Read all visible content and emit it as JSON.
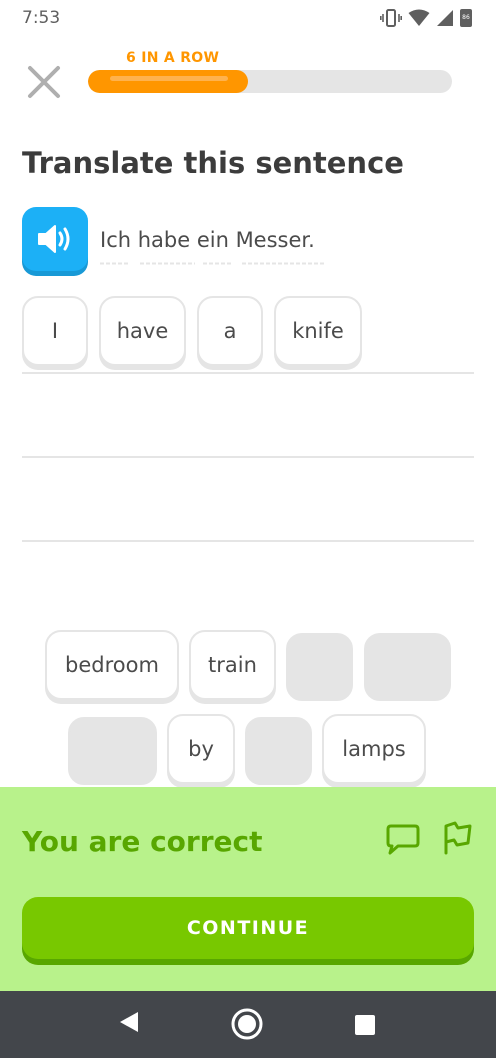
{
  "status_bar": {
    "time": "7:53",
    "battery_level": "86"
  },
  "header": {
    "streak_label": "6 IN A ROW",
    "progress_fraction": 0.44,
    "close_icon": "close-x-icon"
  },
  "exercise": {
    "title": "Translate this sentence",
    "speaker_icon": "speaker-icon",
    "sentence": "Ich habe ein Messer."
  },
  "answer": {
    "selected_words": [
      "I",
      "have",
      "a",
      "knife"
    ]
  },
  "word_bank": {
    "row1": [
      "bedroom",
      "train",
      "",
      ""
    ],
    "row2": [
      "",
      "by",
      "",
      "lamps"
    ]
  },
  "feedback": {
    "title": "You are correct",
    "comment_icon": "comment-icon",
    "flag_icon": "flag-icon",
    "continue_label": "CONTINUE"
  },
  "colors": {
    "accent_orange": "#ff9600",
    "speaker_blue": "#1cb0f6",
    "success_bg": "#b8f28b",
    "success_text": "#58a700",
    "continue_green": "#78c800"
  },
  "nav_bar": {
    "back_icon": "back-triangle-icon",
    "home_icon": "home-circle-icon",
    "recents_icon": "recents-square-icon"
  }
}
